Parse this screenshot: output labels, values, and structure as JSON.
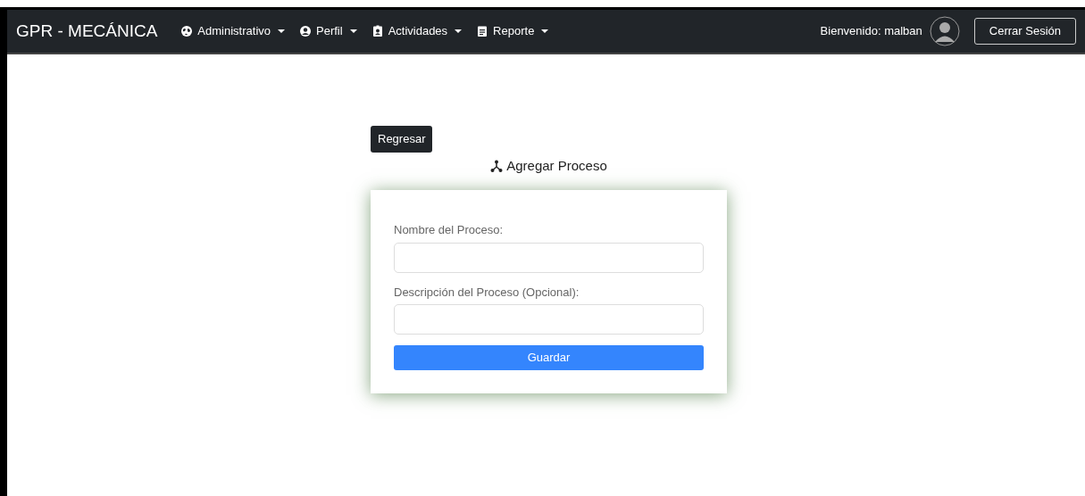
{
  "navbar": {
    "brand": "GPR - MECÁNICA",
    "menus": [
      {
        "label": "Administrativo"
      },
      {
        "label": "Perfil"
      },
      {
        "label": "Actividades"
      },
      {
        "label": "Reporte"
      }
    ],
    "welcome": "Bienvenido: malban",
    "logout": "Cerrar Sesión"
  },
  "back_button": "Regresar",
  "title": "Agregar Proceso",
  "form": {
    "fields": [
      {
        "label": "Nombre del Proceso:"
      },
      {
        "label": "Descripción del Proceso (Opcional):"
      }
    ],
    "submit": "Guardar"
  }
}
